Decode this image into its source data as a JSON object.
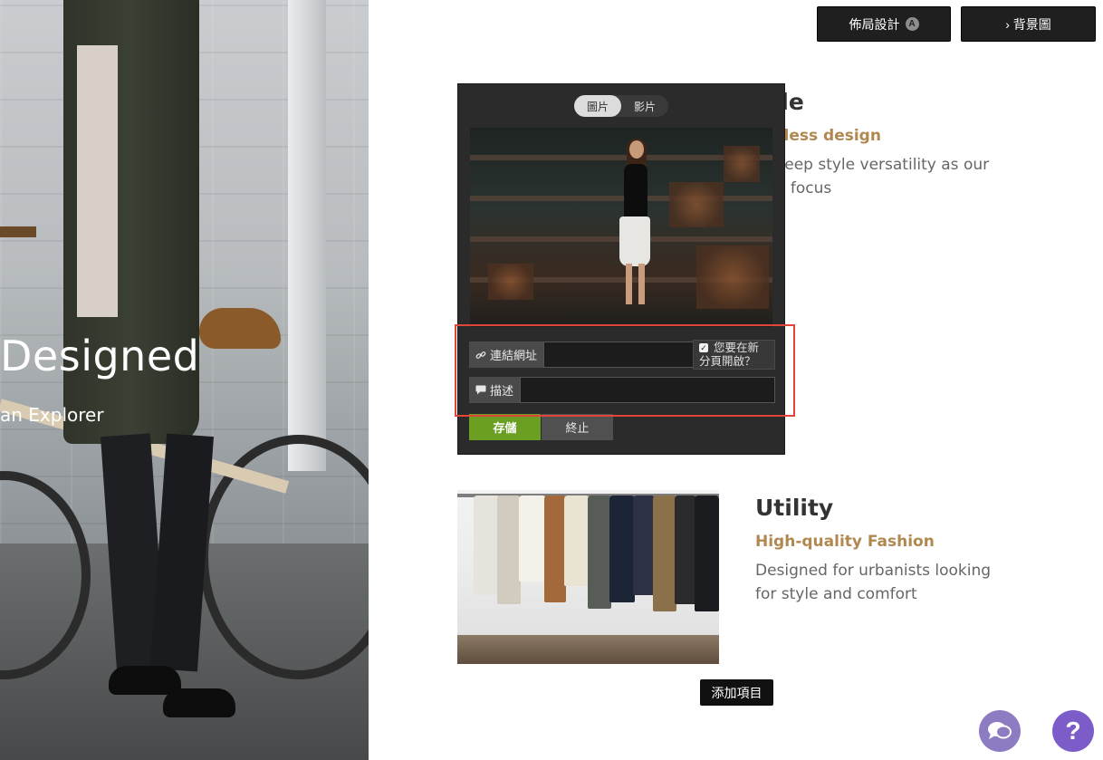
{
  "hero": {
    "title": "Designed",
    "subtitle": "an Explorer"
  },
  "toolbar": {
    "layout_label": "佈局設計",
    "layout_badge": "A",
    "background_label": "› 背景圖"
  },
  "sections": [
    {
      "title": "yle",
      "subtitle": "eless design",
      "description_line1": "keep style versatility as our",
      "description_line2": "e focus"
    },
    {
      "title": "Utility",
      "subtitle": "High-quality Fashion",
      "description_line1": "Designed for urbanists looking",
      "description_line2": "for style and comfort"
    }
  ],
  "editor": {
    "tabs": [
      {
        "label": "圖片",
        "active": true
      },
      {
        "label": "影片",
        "active": false
      }
    ],
    "link_label": "連結網址",
    "link_value": "",
    "new_tab_line1": "您要在新",
    "new_tab_line2": "分頁開啟？",
    "new_tab_checked": true,
    "desc_label": "描述",
    "desc_value": "",
    "save_label": "存儲",
    "cancel_label": "終止"
  },
  "add_item_label": "添加項目",
  "help_label": "?",
  "colors": {
    "accent_gold": "#b08850",
    "save_green": "#6a9f22",
    "highlight_red": "#e0453a",
    "chat_purple": "#8e7cc3",
    "help_purple": "#7b5cc9"
  }
}
